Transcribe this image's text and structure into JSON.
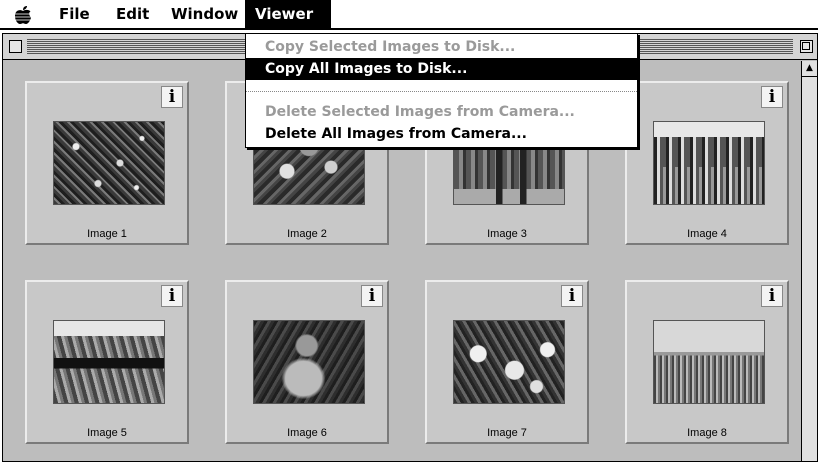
{
  "menubar": {
    "apple_icon": "apple-icon",
    "items": [
      {
        "label": "File"
      },
      {
        "label": "Edit"
      },
      {
        "label": "Window"
      },
      {
        "label": "Viewer",
        "active": true
      }
    ]
  },
  "viewer_menu": {
    "items": [
      {
        "label": "Copy Selected Images to Disk...",
        "enabled": false
      },
      {
        "label": "Copy All Images to Disk...",
        "enabled": true,
        "highlighted": true
      },
      {
        "label": "Delete Selected Images from Camera...",
        "enabled": false
      },
      {
        "label": "Delete All Images from Camera...",
        "enabled": true
      }
    ]
  },
  "info_glyph": "i",
  "scroll_up_glyph": "▲",
  "images": [
    {
      "caption": "Image 1",
      "thumb": "flowers"
    },
    {
      "caption": "Image 2",
      "thumb": "shrub"
    },
    {
      "caption": "Image 3",
      "thumb": "gate"
    },
    {
      "caption": "Image 4",
      "thumb": "people"
    },
    {
      "caption": "Image 5",
      "thumb": "pool"
    },
    {
      "caption": "Image 6",
      "thumb": "statue"
    },
    {
      "caption": "Image 7",
      "thumb": "cosmos"
    },
    {
      "caption": "Image 8",
      "thumb": "field"
    }
  ],
  "colors": {
    "window_background": "#bdbdbd",
    "menu_highlight": "#000000",
    "disabled_text": "#9a9a9a"
  }
}
